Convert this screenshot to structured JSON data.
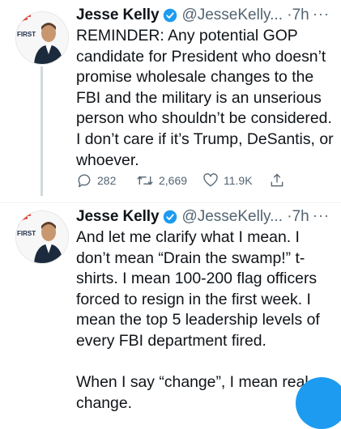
{
  "tweets": [
    {
      "author_name": "Jesse Kelly",
      "handle": "@JesseKelly...",
      "time": "7h",
      "text": "REMINDER: Any potential GOP candidate for President who doesn’t promise wholesale changes to the FBI and the military is an unserious person who shouldn’t be considered. I don’t care if it’s Trump, DeSantis, or whoever.",
      "stats": {
        "replies": "282",
        "retweets": "2,669",
        "likes": "11.9K"
      }
    },
    {
      "author_name": "Jesse Kelly",
      "handle": "@JesseKelly...",
      "time": "7h",
      "text": "And let me clarify what I mean. I don’t mean “Drain the swamp!” t-shirts. I mean 100-200 flag officers forced to resign in the first week. I mean the top 5 leadership levels of every FBI department fired.\n\nWhen I say “change”, I mean real change."
    }
  ],
  "avatar_logo_text": "FIRST",
  "colors": {
    "verified": "#1d9bf0",
    "secondary_text": "#536471",
    "thread_line": "#cfd9de"
  }
}
